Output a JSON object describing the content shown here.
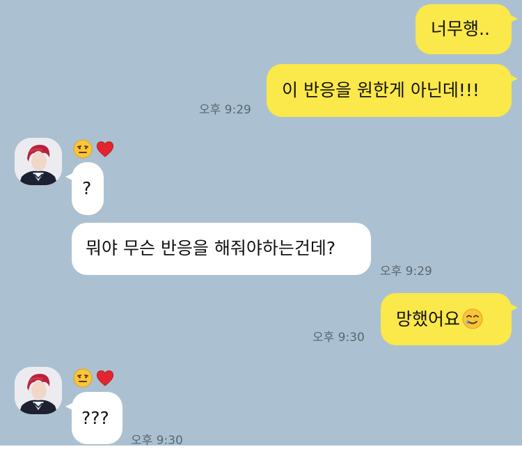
{
  "messages": [
    {
      "sender": "me",
      "text": "너무행.."
    },
    {
      "sender": "me",
      "text": "이 반응을 원한게 아닌데!!!",
      "time": "오후 9:29"
    },
    {
      "sender": "other",
      "text": "?",
      "reactions": [
        "smirk-face-emoji",
        "red-heart-emoji"
      ]
    },
    {
      "sender": "other",
      "text": "뭐야 무슨 반응을 해줘야하는건데?",
      "time": "오후 9:29"
    },
    {
      "sender": "me",
      "text": "망했어요",
      "emoji": "smiling-face-with-tear-emoji",
      "time": "오후 9:30"
    },
    {
      "sender": "other",
      "text": "???",
      "reactions": [
        "smirk-face-emoji",
        "red-heart-emoji"
      ],
      "time": "오후 9:30"
    }
  ],
  "colors": {
    "background": "#abc1d1",
    "my_bubble": "#fbe84a",
    "other_bubble": "#ffffff",
    "timestamp": "#5b6670"
  }
}
